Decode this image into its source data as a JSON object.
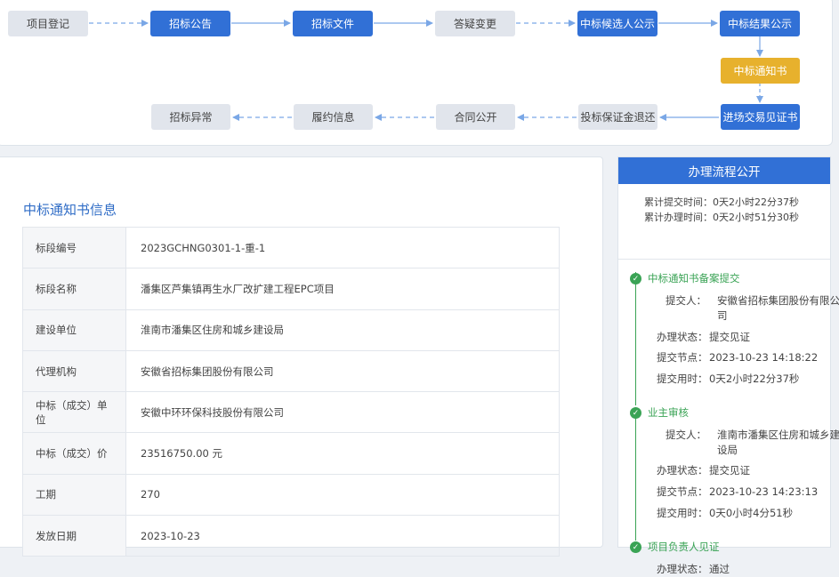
{
  "flow": {
    "nodes": [
      {
        "label": "项目登记"
      },
      {
        "label": "招标公告"
      },
      {
        "label": "招标文件"
      },
      {
        "label": "答疑变更"
      },
      {
        "label": "中标候选人公示"
      },
      {
        "label": "中标结果公示"
      },
      {
        "label": "中标通知书"
      },
      {
        "label": "进场交易见证书"
      },
      {
        "label": "投标保证金退还"
      },
      {
        "label": "合同公开"
      },
      {
        "label": "履约信息"
      },
      {
        "label": "招标异常"
      }
    ]
  },
  "info": {
    "title": "中标通知书信息",
    "rows": [
      {
        "key": "标段编号",
        "value": "2023GCHNG0301-1-重-1"
      },
      {
        "key": "标段名称",
        "value": "潘集区芦集镇再生水厂改扩建工程EPC项目"
      },
      {
        "key": "建设单位",
        "value": "淮南市潘集区住房和城乡建设局"
      },
      {
        "key": "代理机构",
        "value": "安徽省招标集团股份有限公司"
      },
      {
        "key": "中标（成交）单位",
        "value": "安徽中环环保科技股份有限公司"
      },
      {
        "key": "中标（成交）价",
        "value": "23516750.00 元"
      },
      {
        "key": "工期",
        "value": "270"
      },
      {
        "key": "发放日期",
        "value": "2023-10-23"
      }
    ]
  },
  "process": {
    "title": "办理流程公开",
    "total_submit": "累计提交时间：0天2小时22分37秒",
    "total_handle": "累计办理时间：0天2小时51分30秒",
    "steps": [
      {
        "title": "中标通知书备案提交",
        "submitter_label": "提交人：",
        "submitter": "安徽省招标集团股份有限公司",
        "status_label": "办理状态：",
        "status": "提交见证",
        "node_label": "提交节点：",
        "node": "2023-10-23 14:18:22",
        "time_label": "提交用时：",
        "time": "0天2小时22分37秒"
      },
      {
        "title": "业主审核",
        "submitter_label": "提交人：",
        "submitter": "淮南市潘集区住房和城乡建设局",
        "status_label": "办理状态：",
        "status": "提交见证",
        "node_label": "提交节点：",
        "node": "2023-10-23 14:23:13",
        "time_label": "提交用时：",
        "time": "0天0小时4分51秒"
      },
      {
        "title": "项目负责人见证",
        "status_label": "办理状态：",
        "status": "通过"
      }
    ]
  },
  "colors": {
    "primary": "#3170d6",
    "highlight": "#e7b12d",
    "success": "#3aa355",
    "node_grey": "#e1e5ec"
  }
}
